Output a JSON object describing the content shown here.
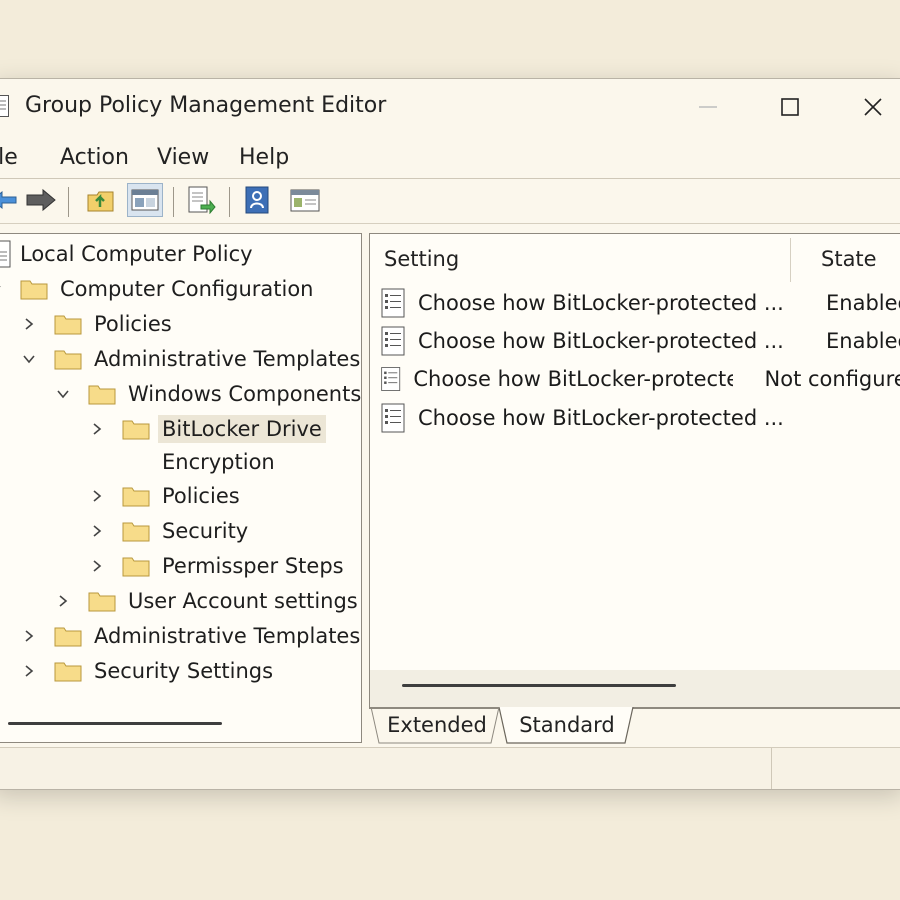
{
  "window": {
    "title": "Group Policy Management Editor"
  },
  "menu": {
    "file": "File",
    "action": "Action",
    "view": "View",
    "help": "Help"
  },
  "toolbar": {
    "buttons": [
      "back-arrow-icon",
      "forward-arrow-icon",
      "up-folder-icon",
      "show-hide-tree-icon",
      "export-list-icon",
      "help-icon",
      "properties-icon"
    ],
    "pressed": "show-hide-tree-icon"
  },
  "tree": {
    "root": "Local Computer Policy",
    "computer_configuration": "Computer Configuration",
    "policies": "Policies",
    "administrative_templates": "Administrative Templates",
    "windows_components": "Windows Components",
    "bitlocker_line1": "BitLocker Drive",
    "bitlocker_line2": "Encryption",
    "wc_policies": "Policies",
    "security": "Security",
    "permissper_steps": "Permissper Steps",
    "user_account_settings": "User Account settings",
    "administrative_templates_2": "Administrative Templates",
    "security_settings": "Security Settings"
  },
  "list": {
    "headers": {
      "setting": "Setting",
      "state": "State"
    },
    "rows": [
      {
        "setting": "Choose how BitLocker-protected ...",
        "state": "Enabled"
      },
      {
        "setting": "Choose how BitLocker-protected ...",
        "state": "Enabled"
      },
      {
        "setting": "Choose how BitLocker-protected ...",
        "state": "Not configured"
      },
      {
        "setting": "Choose how BitLocker-protected ...",
        "state": ""
      }
    ]
  },
  "tabs": {
    "extended": "Extended",
    "standard": "Standard",
    "active": "standard"
  },
  "colors": {
    "folder_fill": "#f7dc8a",
    "folder_stroke": "#b8983c",
    "accent_blue": "#2f68b0"
  }
}
